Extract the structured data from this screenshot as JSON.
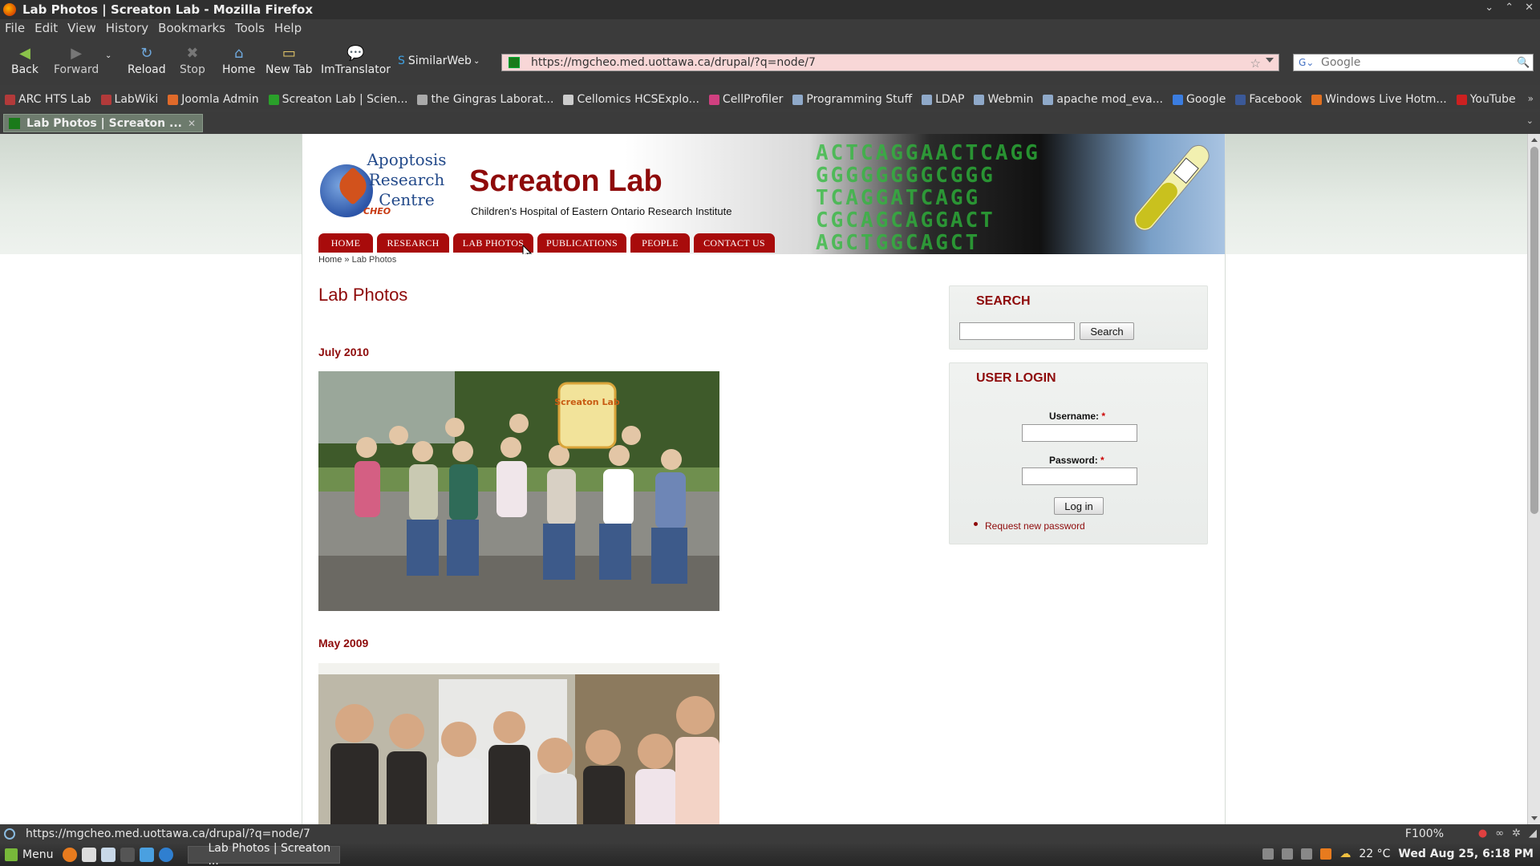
{
  "window": {
    "title": "Lab Photos | Screaton Lab - Mozilla Firefox"
  },
  "menubar": [
    "File",
    "Edit",
    "View",
    "History",
    "Bookmarks",
    "Tools",
    "Help"
  ],
  "toolbar": {
    "back": "Back",
    "forward": "Forward",
    "reload": "Reload",
    "stop": "Stop",
    "home": "Home",
    "new_tab": "New Tab",
    "imtranslator": "ImTranslator",
    "similarweb": "SimilarWeb"
  },
  "urlbar": {
    "url": "https://mgcheo.med.uottawa.ca/drupal/?q=node/7"
  },
  "searchbar": {
    "placeholder": "Google"
  },
  "bookmarks": [
    {
      "label": "ARC HTS Lab",
      "icon": "book-icon",
      "color": "#b23a3a"
    },
    {
      "label": "LabWiki",
      "icon": "book-icon",
      "color": "#b23a3a"
    },
    {
      "label": "Joomla Admin",
      "icon": "joomla-icon",
      "color": "#e06a2a"
    },
    {
      "label": "Screaton Lab | Scien...",
      "icon": "leaf-icon",
      "color": "#2aa02a"
    },
    {
      "label": "the Gingras Laborat...",
      "icon": "globe-icon",
      "color": "#aaaaaa"
    },
    {
      "label": "Cellomics HCSExplo...",
      "icon": "page-icon",
      "color": "#cccccc"
    },
    {
      "label": "CellProfiler",
      "icon": "cellprofiler-icon",
      "color": "#d04080"
    },
    {
      "label": "Programming Stuff",
      "icon": "folder-icon",
      "color": "#8fa9c9"
    },
    {
      "label": "LDAP",
      "icon": "folder-icon",
      "color": "#8fa9c9"
    },
    {
      "label": "Webmin",
      "icon": "folder-icon",
      "color": "#8fa9c9"
    },
    {
      "label": "apache mod_eva...",
      "icon": "folder-icon",
      "color": "#8fa9c9"
    },
    {
      "label": "Google",
      "icon": "google-icon",
      "color": "#3b7de0"
    },
    {
      "label": "Facebook",
      "icon": "facebook-icon",
      "color": "#3b5998"
    },
    {
      "label": "Windows Live Hotm...",
      "icon": "hotmail-icon",
      "color": "#e07020"
    },
    {
      "label": "YouTube",
      "icon": "youtube-icon",
      "color": "#cc2020"
    }
  ],
  "tab": {
    "label": "Lab Photos | Screaton ..."
  },
  "site": {
    "logo_text": [
      "Apoptosis",
      "Research",
      "Centre"
    ],
    "logo_sub": "CHEO",
    "name": "Screaton Lab",
    "slogan": "Children's Hospital of Eastern Ontario Research Institute",
    "nav": [
      "HOME",
      "RESEARCH",
      "LAB PHOTOS",
      "PUBLICATIONS",
      "PEOPLE",
      "CONTACT US"
    ],
    "breadcrumb_home": "Home",
    "breadcrumb_sep": "»",
    "breadcrumb_current": "Lab Photos",
    "page_title": "Lab Photos",
    "sections": [
      {
        "heading": "July 2010"
      },
      {
        "heading": "May 2009"
      }
    ],
    "mug_text": "Screaton Lab"
  },
  "search_block": {
    "title": "SEARCH",
    "button": "Search"
  },
  "login_block": {
    "title": "USER LOGIN",
    "username_label": "Username:",
    "password_label": "Password:",
    "required_mark": "*",
    "login_button": "Log in",
    "request_link": "Request new password"
  },
  "statusbar": {
    "url": "https://mgcheo.med.uottawa.ca/drupal/?q=node/7",
    "zoom": "F100%"
  },
  "taskbar": {
    "menu": "Menu",
    "task": "Lab Photos | Screaton ...",
    "weather": "22 °C",
    "clock": "Wed Aug 25,  6:18 PM"
  }
}
